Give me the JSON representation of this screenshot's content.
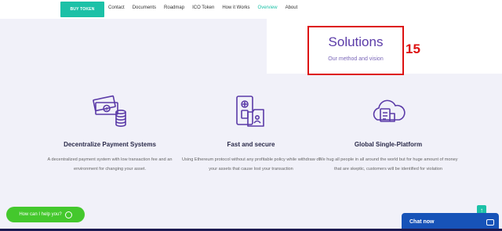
{
  "nav": {
    "buy_token": "BUY TOKEN",
    "links": [
      "Contact",
      "Documents",
      "Roadmap",
      "ICO Token",
      "How it Works",
      "Overview",
      "About"
    ],
    "active": "Overview"
  },
  "section": {
    "title": "Solutions",
    "subtitle": "Our method and vision",
    "annotation": "15"
  },
  "features": [
    {
      "title": "Decentralize Payment Systems",
      "text": "A decentralized payment system with low transaction fee and an environment for changing your asset.",
      "icon": "money-coins-icon"
    },
    {
      "title": "Fast and secure",
      "text": "Using Ethereum protocol without any profitable policy while withdraw of your assets that cause lost your transaction",
      "icon": "secure-folder-icon"
    },
    {
      "title": "Global Single-Platform",
      "text": "We hug all people in all around the world but for huge amount of money that are skeptic, customers will be identified for violation",
      "icon": "cloud-platform-icon"
    }
  ],
  "help": {
    "label": "How can I help you?"
  },
  "scroll_top": "↑",
  "chat": {
    "label": "Chat now"
  },
  "colors": {
    "accent": "#1cc1a7",
    "icon_purple": "#5b3ba8",
    "highlight_red": "#dd1111",
    "help_green": "#44c82d",
    "chat_blue": "#1753b8"
  }
}
